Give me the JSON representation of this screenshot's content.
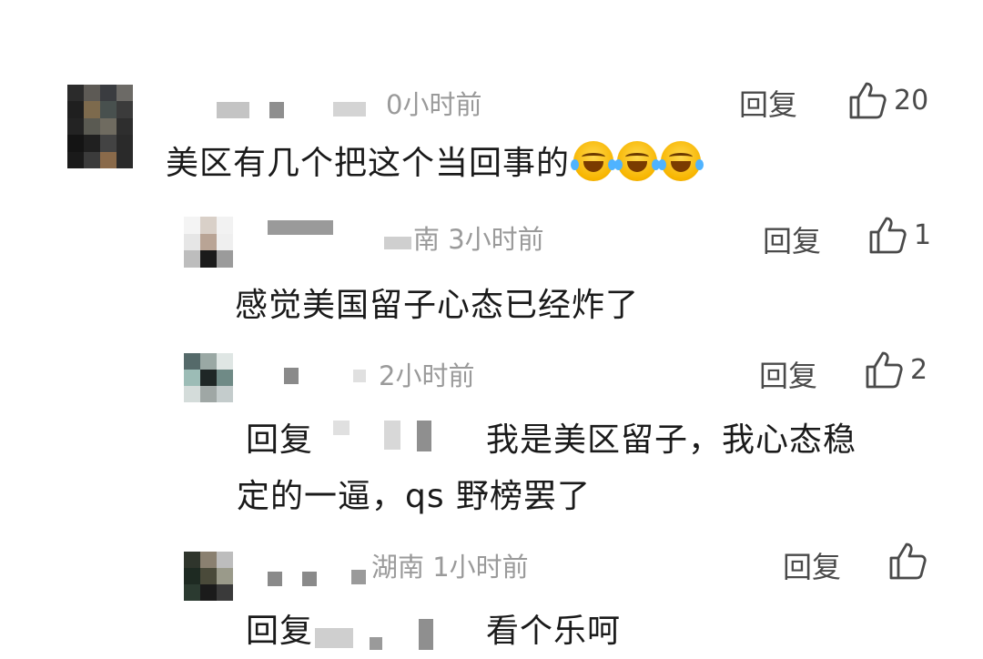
{
  "comments": [
    {
      "meta": "0小时前",
      "reply": "回复",
      "likes": "20",
      "text": "美区有几个把这个当回事的",
      "emoji": "laughing-tears-emoji"
    },
    {
      "meta": "南 3小时前",
      "reply": "回复",
      "likes": "1",
      "text": "感觉美国留子心态已经炸了"
    },
    {
      "meta": "2小时前",
      "reply": "回复",
      "likes": "2",
      "text_prefix": "回复",
      "text_line1": "我是美区留子，我心态稳",
      "text_line2": "定的一逼，qs 野榜罢了"
    },
    {
      "meta": "湖南 1小时前",
      "reply": "回复",
      "likes": "",
      "text_prefix": "回复",
      "text_line1": "看个乐呵"
    }
  ]
}
